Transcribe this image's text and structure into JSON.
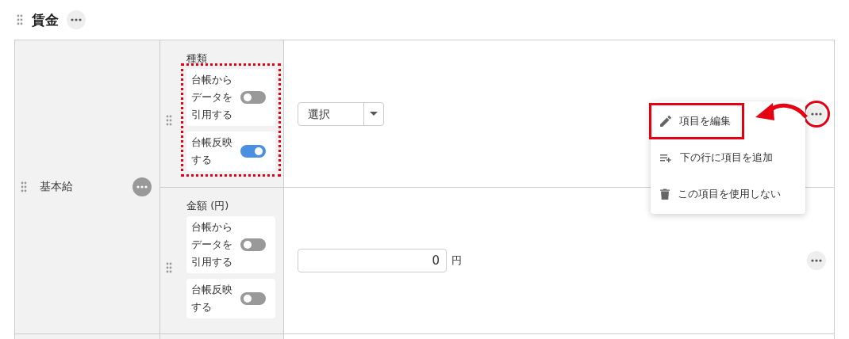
{
  "section": {
    "title": "賃金"
  },
  "rows": [
    {
      "name": "基本給",
      "fields": [
        {
          "label": "種類",
          "highlighted": true,
          "toggles": [
            {
              "label": "台帳からデータを引用する",
              "on": false
            },
            {
              "label": "台帳反映する",
              "on": true
            }
          ],
          "control": {
            "kind": "select",
            "value": "選択"
          },
          "menu_target": true
        },
        {
          "label": "金額 (円)",
          "toggles": [
            {
              "label": "台帳からデータを引用する",
              "on": false
            },
            {
              "label": "台帳反映する",
              "on": false
            }
          ],
          "control": {
            "kind": "number",
            "value": "0",
            "unit": "円"
          },
          "menu_target": false
        }
      ]
    }
  ],
  "menu": {
    "items": [
      {
        "label": "項目を編集",
        "kind": "edit",
        "highlighted": true
      },
      {
        "label": "下の行に項目を追加",
        "kind": "add-row",
        "highlighted": false
      },
      {
        "label": "この項目を使用しない",
        "kind": "trash",
        "highlighted": false
      }
    ]
  }
}
